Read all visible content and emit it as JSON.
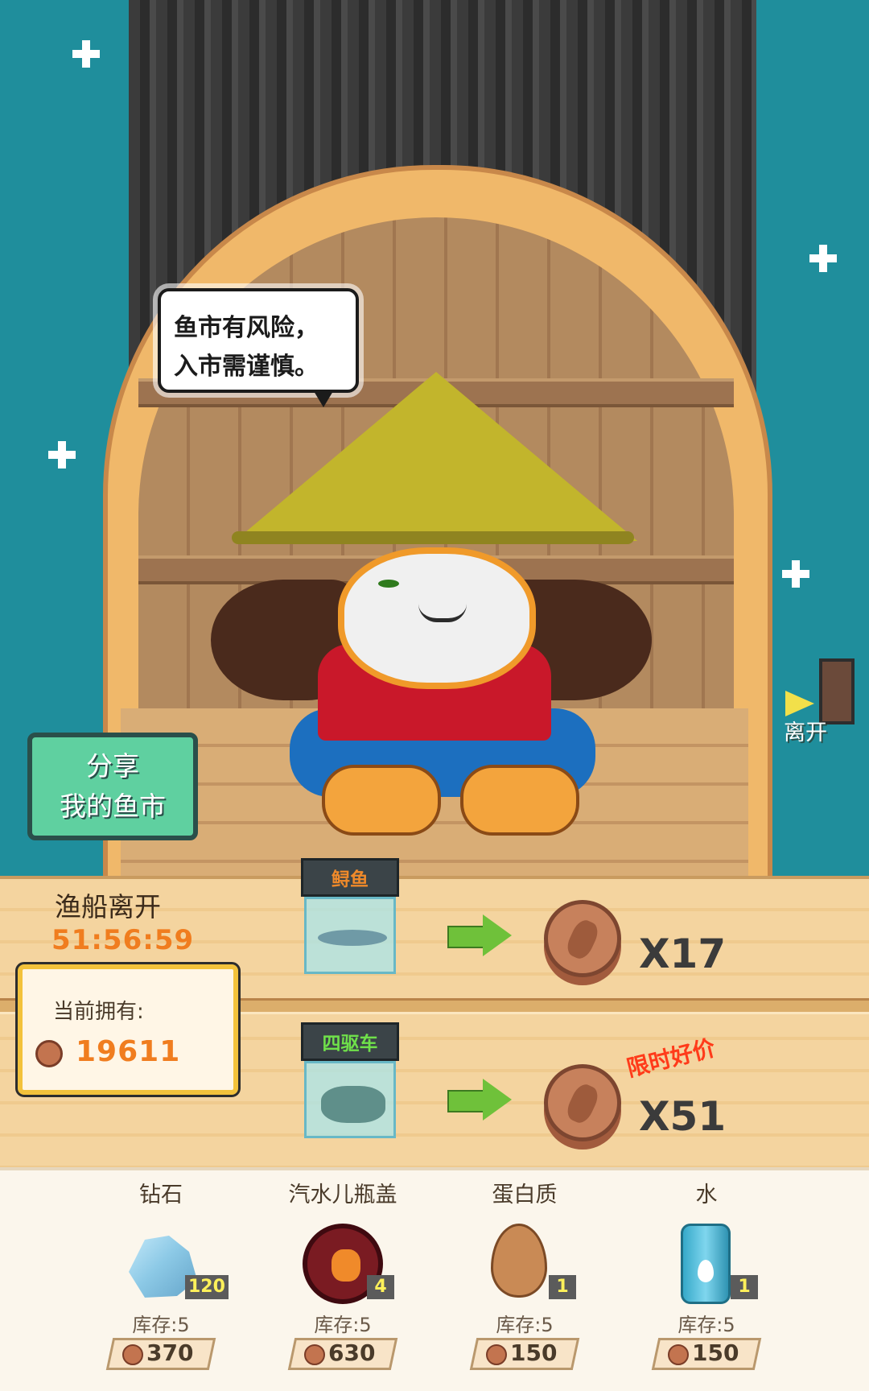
{
  "scene": {
    "speech_bubble": {
      "line1": "鱼市有风险，",
      "line2": "入市需谨慎。"
    },
    "share_button": {
      "line1": "分享",
      "line2": "我的鱼市"
    },
    "leave_button": {
      "label": "离开"
    }
  },
  "market": {
    "boat_departure_label": "渔船离开",
    "countdown": "51:56:59",
    "owned": {
      "label": "当前拥有:",
      "coins": "19611"
    },
    "offers": [
      {
        "item_label": "鲟鱼",
        "multiplier": "X17",
        "label_color": "#f08a2a"
      },
      {
        "item_label": "四驱车",
        "multiplier": "X51",
        "label_color": "#6fe04a",
        "promo": "限时好价"
      }
    ]
  },
  "shop": {
    "items": [
      {
        "name": "钻石",
        "count": "120",
        "stock": "库存:5",
        "price": "370",
        "icon": "diamond-icon"
      },
      {
        "name": "汽水儿瓶盖",
        "count": "4",
        "stock": "库存:5",
        "price": "630",
        "icon": "bottle-cap-icon"
      },
      {
        "name": "蛋白质",
        "count": "1",
        "stock": "库存:5",
        "price": "150",
        "icon": "egg-icon"
      },
      {
        "name": "水",
        "count": "1",
        "stock": "库存:5",
        "price": "150",
        "icon": "water-can-icon"
      }
    ]
  },
  "colors": {
    "sea": "#1f8e9c",
    "accent_orange": "#f07d1f",
    "share_green": "#5fd0a0",
    "promo_red": "#ff3b1a"
  }
}
